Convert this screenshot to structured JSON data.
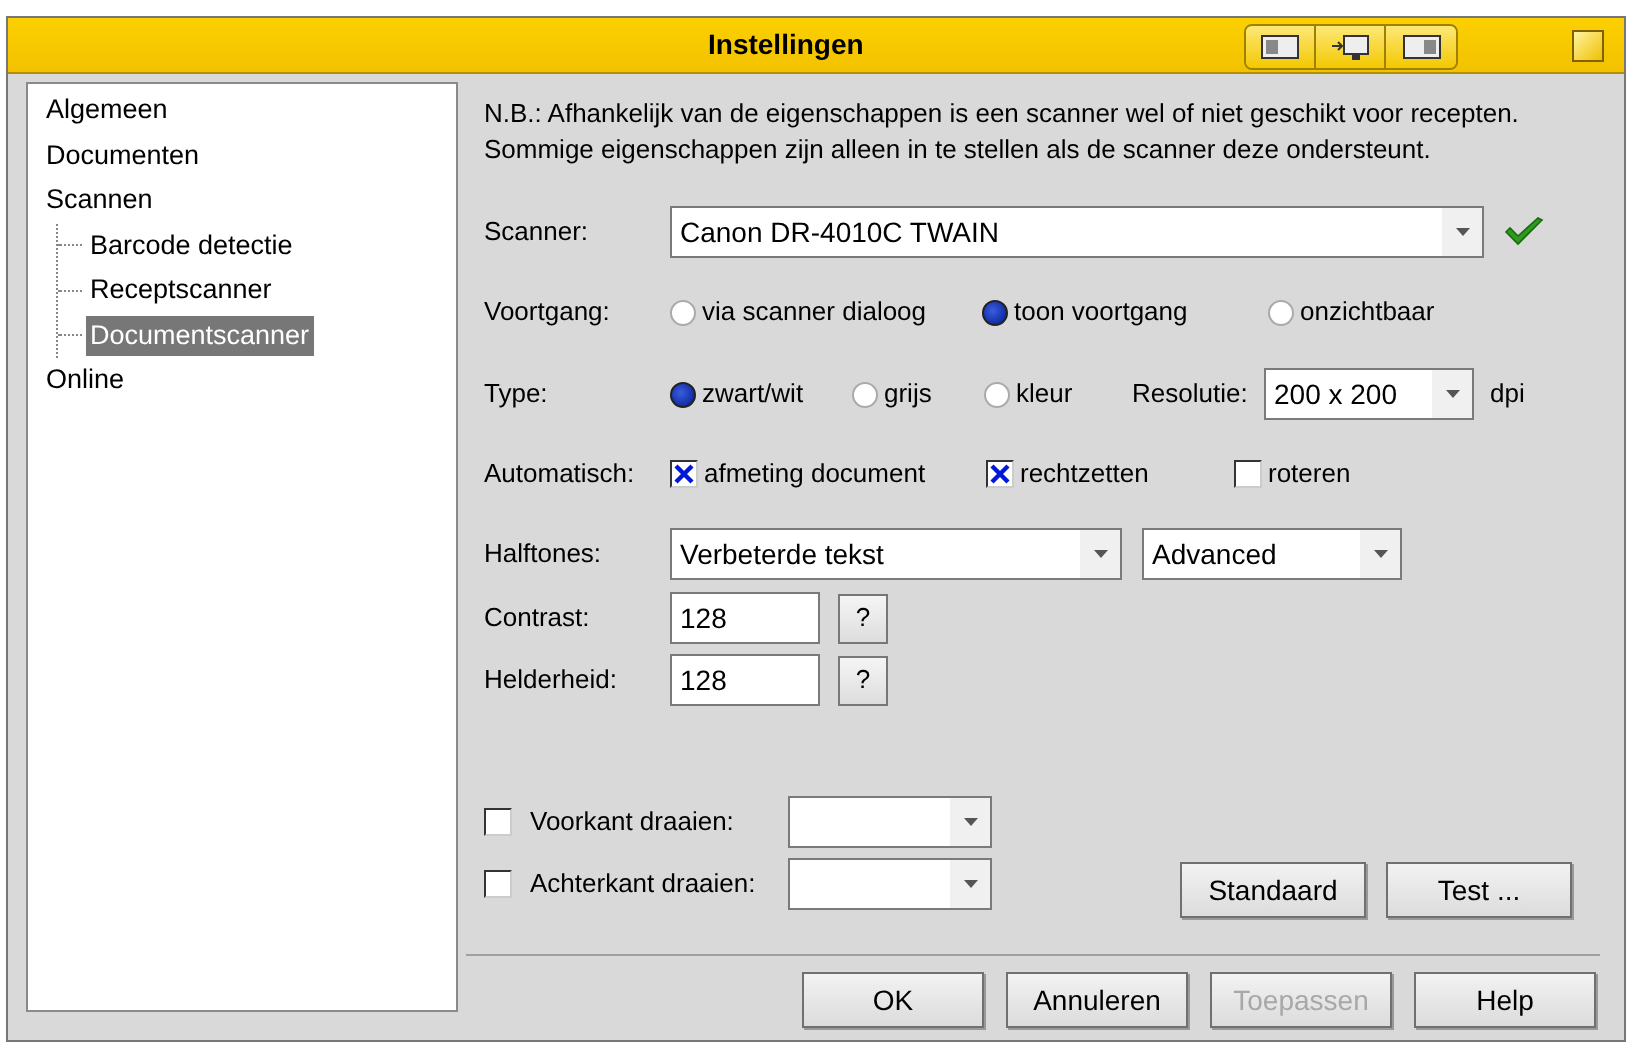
{
  "window": {
    "title": "Instellingen"
  },
  "tree": [
    {
      "label": "Algemeen",
      "selected": false
    },
    {
      "label": "Documenten",
      "selected": false
    },
    {
      "label": "Scannen",
      "selected": false,
      "children": [
        {
          "label": "Barcode detectie",
          "selected": false
        },
        {
          "label": "Receptscanner",
          "selected": false
        },
        {
          "label": "Documentscanner",
          "selected": true
        }
      ]
    },
    {
      "label": "Online",
      "selected": false
    }
  ],
  "note": [
    "N.B.: Afhankelijk van de eigenschappen is een scanner wel of niet geschikt voor recepten.",
    "Sommige eigenschappen zijn alleen in te stellen als de scanner deze ondersteunt."
  ],
  "scanner": {
    "label": "Scanner:",
    "value": "Canon DR-4010C TWAIN",
    "valid": true
  },
  "progress": {
    "label": "Voortgang:",
    "options": [
      {
        "label": "via scanner dialoog",
        "selected": false
      },
      {
        "label": "toon voortgang",
        "selected": true
      },
      {
        "label": "onzichtbaar",
        "selected": false
      }
    ]
  },
  "type": {
    "label": "Type:",
    "options": [
      {
        "label": "zwart/wit",
        "selected": true
      },
      {
        "label": "grijs",
        "selected": false
      },
      {
        "label": "kleur",
        "selected": false
      }
    ]
  },
  "resolution": {
    "label": "Resolutie:",
    "value": "200 x 200",
    "unit": "dpi"
  },
  "automatic": {
    "label": "Automatisch:",
    "options": [
      {
        "label": "afmeting document",
        "checked": true
      },
      {
        "label": "rechtzetten",
        "checked": true
      },
      {
        "label": "roteren",
        "checked": false
      }
    ]
  },
  "halftones": {
    "label": "Halftones:",
    "value": "Verbeterde tekst",
    "mode": "Advanced"
  },
  "levels": [
    {
      "label": "Contrast:",
      "value": "128",
      "help": "?"
    },
    {
      "label": "Helderheid:",
      "value": "128",
      "help": "?"
    }
  ],
  "rotate": [
    {
      "label": "Voorkant draaien:",
      "checked": false
    },
    {
      "label": "Achterkant draaien:",
      "checked": false
    }
  ],
  "action_buttons": [
    {
      "label": "Standaard",
      "disabled": false
    },
    {
      "label": "Test ...",
      "disabled": false
    }
  ],
  "dialog_buttons": [
    {
      "label": "OK",
      "disabled": false
    },
    {
      "label": "Annuleren",
      "disabled": false
    },
    {
      "label": "Toepassen",
      "disabled": true
    },
    {
      "label": "Help",
      "disabled": false
    }
  ]
}
